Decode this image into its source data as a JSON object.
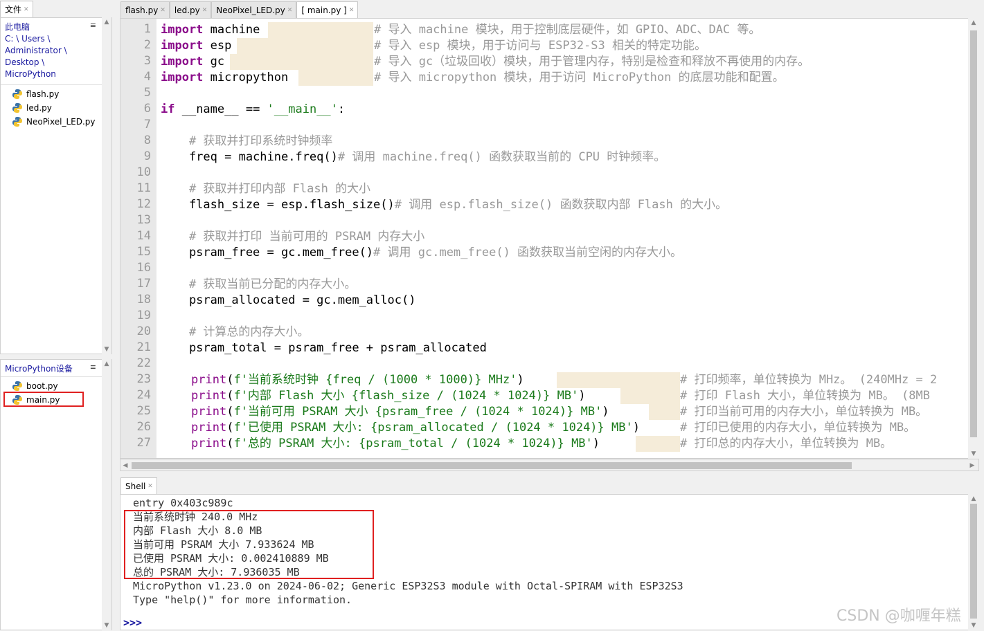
{
  "files_panel": {
    "tab_label": "文件",
    "this_pc": "此电脑",
    "path_segments": [
      "C: \\ Users \\",
      "Administrator \\",
      "Desktop \\",
      "MicroPython"
    ],
    "menu_icon": "hamburger-icon",
    "computer_files": [
      "flash.py",
      "led.py",
      "NeoPixel_LED.py"
    ],
    "device_title": "MicroPython设备",
    "device_files": [
      "boot.py",
      "main.py"
    ]
  },
  "editor": {
    "tabs": [
      {
        "label": "flash.py"
      },
      {
        "label": "led.py"
      },
      {
        "label": "NeoPixel_LED.py"
      },
      {
        "label": "[ main.py ]",
        "active": true
      }
    ],
    "line_numbers": [
      "1",
      "2",
      "3",
      "4",
      "5",
      "6",
      "7",
      "8",
      "9",
      "10",
      "11",
      "12",
      "13",
      "14",
      "15",
      "16",
      "17",
      "18",
      "19",
      "20",
      "21",
      "22",
      "23",
      "24",
      "25",
      "26",
      "27"
    ],
    "code": {
      "l1_kw": "import",
      "l1_rest": " machine",
      "l1_cm": "# 导入 machine 模块，用于控制底层硬件，如 GPIO、ADC、DAC 等。",
      "l2_kw": "import",
      "l2_rest": " esp",
      "l2_cm": "# 导入 esp 模块，用于访问与 ESP32-S3 相关的特定功能。",
      "l3_kw": "import",
      "l3_rest": " gc",
      "l3_cm": "# 导入 gc（垃圾回收）模块，用于管理内存，特别是检查和释放不再使用的内存。",
      "l4_kw": "import",
      "l4_rest": " micropython",
      "l4_cm": "# 导入 micropython 模块，用于访问 MicroPython 的底层功能和配置。",
      "l6_kw": "if",
      "l6_mid": " __name__ == ",
      "l6_str": "'__main__'",
      "l6_end": ":",
      "l8_cm": "    # 获取并打印系统时钟频率",
      "l9_code": "    freq = machine.freq()",
      "l9_cm": "# 调用 machine.freq() 函数获取当前的 CPU 时钟频率。",
      "l11_cm": "    # 获取并打印内部 Flash 的大小",
      "l12_code": "    flash_size = esp.flash_size()",
      "l12_cm": "# 调用 esp.flash_size() 函数获取内部 Flash 的大小。",
      "l14_cm": "    # 获取并打印 当前可用的 PSRAM 内存大小",
      "l15_code": "    psram_free = gc.mem_free()",
      "l15_cm": "# 调用 gc.mem_free() 函数获取当前空闲的内存大小。",
      "l17_cm": "    # 获取当前已分配的内存大小。",
      "l18_code": "    psram_allocated = gc.mem_alloc()",
      "l20_cm": "    # 计算总的内存大小。",
      "l21_code": "    psram_total = psram_free + psram_allocated",
      "l23_fn": "print",
      "l23_a": "(",
      "l23_str": "f'当前系统时钟 {freq / (1000 * 1000)} MHz'",
      "l23_b": ")",
      "l23_cm": "# 打印频率，单位转换为 MHz。 (240MHz = 2",
      "l24_fn": "print",
      "l24_a": "(",
      "l24_str": "f'内部 Flash 大小 {flash_size / (1024 * 1024)} MB'",
      "l24_b": ")",
      "l24_cm": "# 打印 Flash 大小，单位转换为 MB。 (8MB",
      "l25_fn": "print",
      "l25_a": "(",
      "l25_str": "f'当前可用 PSRAM 大小 {psram_free / (1024 * 1024)} MB'",
      "l25_b": ")",
      "l25_cm": "# 打印当前可用的内存大小，单位转换为 MB。",
      "l26_fn": "print",
      "l26_a": "(",
      "l26_str": "f'已使用 PSRAM 大小: {psram_allocated / (1024 * 1024)} MB'",
      "l26_b": ")",
      "l26_cm": "# 打印已使用的内存大小，单位转换为 MB。",
      "l27_fn": "print",
      "l27_a": "(",
      "l27_str": "f'总的 PSRAM 大小: {psram_total / (1024 * 1024)} MB'",
      "l27_b": ")",
      "l27_cm": "# 打印总的内存大小，单位转换为 MB。"
    }
  },
  "shell": {
    "tab_label": "Shell",
    "lines": [
      "entry 0x403c989c",
      "当前系统时钟 240.0 MHz",
      "内部 Flash 大小 8.0 MB",
      "当前可用 PSRAM 大小 7.933624 MB",
      "已使用 PSRAM 大小: 0.002410889 MB",
      "总的 PSRAM 大小: 7.936035 MB",
      "MicroPython v1.23.0 on 2024-06-02; Generic ESP32S3 module with Octal-SPIRAM with ESP32S3",
      "Type \"help()\" for more information."
    ],
    "prompt": ">>>"
  },
  "watermark": "CSDN @咖喱年糕",
  "colors": {
    "keyword": "#8a0b8a",
    "string": "#1a7a1a",
    "comment": "#999999",
    "highlight": "#e02020",
    "pad": "#f5ecd9"
  }
}
